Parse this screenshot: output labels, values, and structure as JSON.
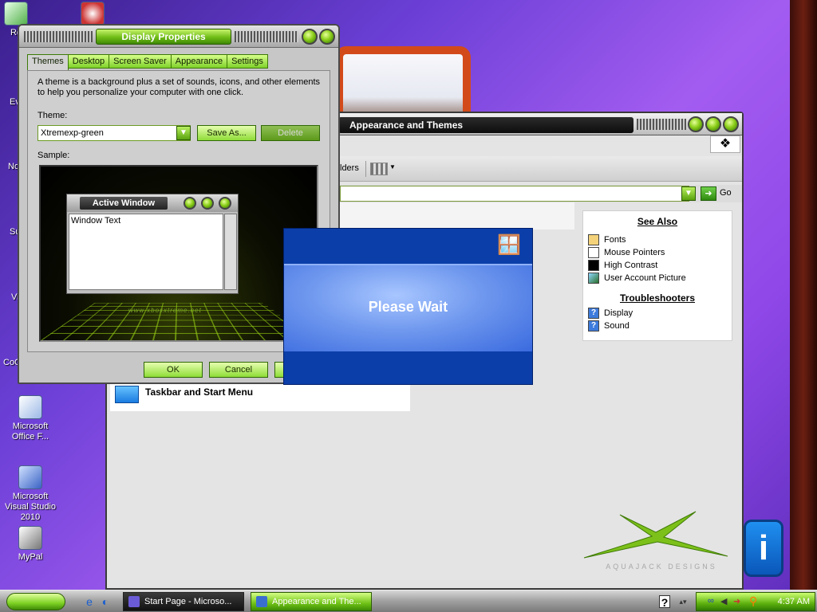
{
  "desktop": {
    "icons": [
      {
        "label": "Re",
        "partial": true
      },
      {
        "label": "Ev",
        "partial": true
      },
      {
        "label": "No",
        "partial": true
      },
      {
        "label": "Su",
        "partial": true
      },
      {
        "label": "Vi",
        "partial": true
      },
      {
        "label": "CoC",
        "partial": true
      },
      {
        "label": "Microsoft Office F..."
      },
      {
        "label": "Microsoft Visual Studio 2010"
      },
      {
        "label": "MyPal"
      }
    ]
  },
  "appearance_window": {
    "title": "Appearance and Themes",
    "toolbar_fragment": "lders",
    "address_go": "Go",
    "see_also": {
      "heading": "See Also",
      "items": [
        "Fonts",
        "Mouse Pointers",
        "High Contrast",
        "User Account Picture"
      ]
    },
    "troubleshooters": {
      "heading": "Troubleshooters",
      "items": [
        "Display",
        "Sound"
      ]
    },
    "task_item": "Taskbar and Start Menu",
    "brand_text": "AQUAJACK  DESIGNS"
  },
  "display_properties": {
    "title": "Display Properties",
    "tabs": [
      "Themes",
      "Desktop",
      "Screen Saver",
      "Appearance",
      "Settings"
    ],
    "description": "A theme is a background plus a set of sounds, icons, and other elements to help you personalize your computer with one click.",
    "theme_label": "Theme:",
    "theme_value": "Xtremexp-green",
    "save_as": "Save As...",
    "delete": "Delete",
    "sample_label": "Sample:",
    "sample": {
      "active_window": "Active Window",
      "window_text": "Window Text",
      "url": "www.xboxxtreme.net"
    },
    "ok": "OK",
    "cancel": "Cancel"
  },
  "please_wait": {
    "message": "Please Wait"
  },
  "taskbar": {
    "buttons": [
      {
        "label": "Start Page - Microso..."
      },
      {
        "label": "Appearance and The..."
      }
    ],
    "clock": "4:37 AM"
  },
  "colors": {
    "accent_green": "#7ed123",
    "dialog_blue": "#0b3ea8"
  }
}
